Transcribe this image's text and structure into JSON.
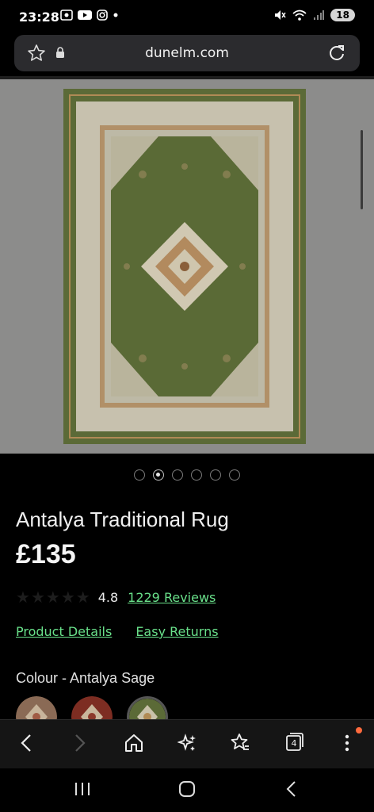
{
  "status": {
    "time": "23:28",
    "battery": "18"
  },
  "browser": {
    "domain": "dunelm.com"
  },
  "product": {
    "title": "Antalya Traditional Rug",
    "price": "£135",
    "rating": "4.8",
    "reviews": "1229 Reviews",
    "link_details": "Product Details",
    "link_returns": "Easy Returns",
    "colour_label": "Colour - Antalya Sage"
  },
  "carousel": {
    "count": 6,
    "active": 2
  },
  "tabs_count": "4"
}
